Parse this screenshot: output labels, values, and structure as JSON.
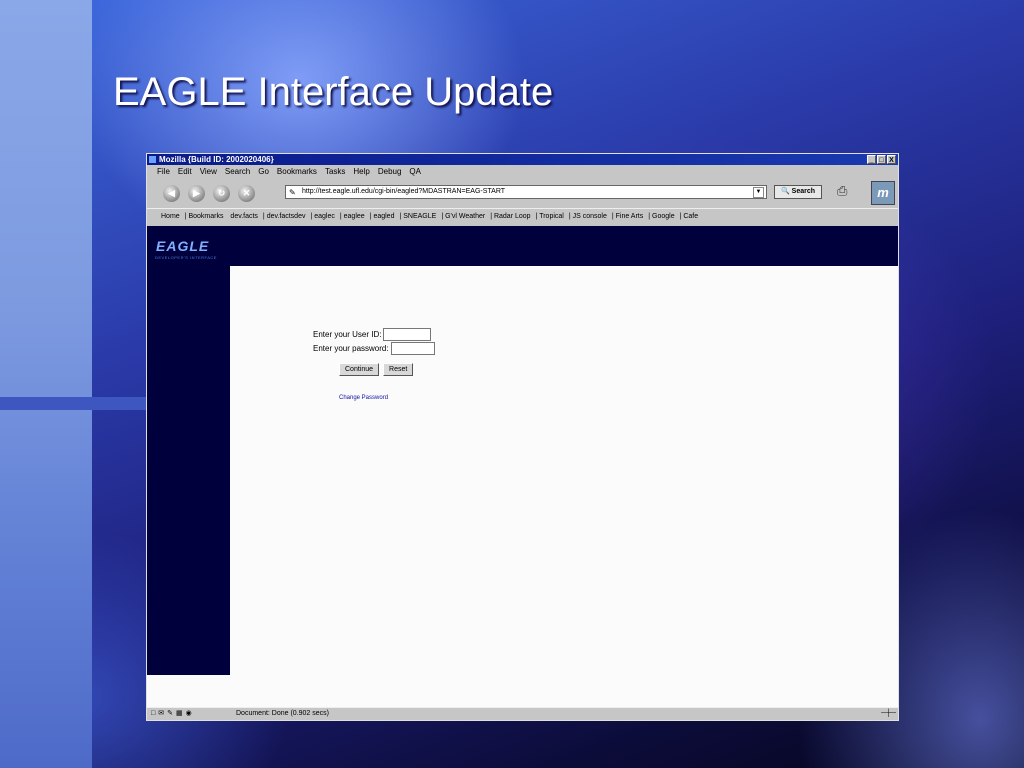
{
  "slide": {
    "title": "EAGLE Interface Update"
  },
  "browser": {
    "title": "Mozilla {Build ID: 2002020406}",
    "window_controls": [
      "_",
      "□",
      "X"
    ],
    "menu": [
      "File",
      "Edit",
      "View",
      "Search",
      "Go",
      "Bookmarks",
      "Tasks",
      "Help",
      "Debug",
      "QA"
    ],
    "url": "http://test.eagle.ufl.edu/cgi-bin/eagled?MDASTRAN=EAG-START",
    "search_label": "Search",
    "bookmarks": [
      "Home",
      "Bookmarks",
      "dev.facts",
      "dev.factsdev",
      "eaglec",
      "eaglee",
      "eagled",
      "SNEAGLE",
      "G'vl Weather",
      "Radar Loop",
      "Tropical",
      "JS console",
      "Fine Arts",
      "Google",
      "Cafe"
    ],
    "status": "Document: Done (0.902 secs)"
  },
  "eagle": {
    "logo": "EAGLE",
    "subtitle": "DEVELOPER'S INTERFACE"
  },
  "form": {
    "user_id_label": "Enter your User ID:",
    "password_label": "Enter your password:",
    "continue_label": "Continue",
    "reset_label": "Reset",
    "change_password": "Change Password"
  }
}
